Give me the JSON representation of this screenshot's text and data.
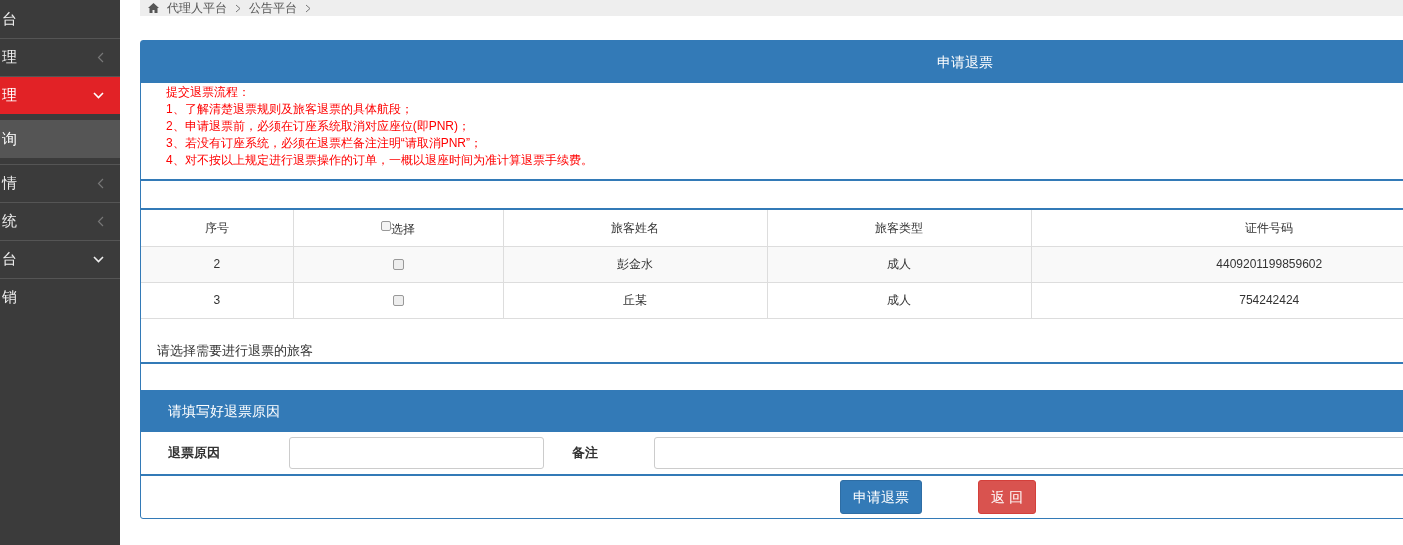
{
  "sidebar": {
    "items": [
      {
        "label": "台",
        "selected": false,
        "kind": "link"
      },
      {
        "label": "理",
        "selected": false,
        "kind": "collapsed"
      },
      {
        "label": "理",
        "selected": true,
        "kind": "expanded"
      },
      {
        "label": "询",
        "selected": false,
        "kind": "sub"
      },
      {
        "label": "情",
        "selected": false,
        "kind": "collapsed"
      },
      {
        "label": "统",
        "selected": false,
        "kind": "collapsed"
      },
      {
        "label": "台",
        "selected": false,
        "kind": "expanded"
      },
      {
        "label": "销",
        "selected": false,
        "kind": "link"
      }
    ]
  },
  "breadcrumb": [
    "代理人平台",
    "公告平台"
  ],
  "panel": {
    "title": "申请退票",
    "notice": [
      "提交退票流程：",
      "1、了解清楚退票规则及旅客退票的具体航段；",
      "2、申请退票前，必须在订座系统取消对应座位(即PNR)；",
      "3、若没有订座系统，必须在退票栏备注注明“请取消PNR”；",
      "4、对不按以上规定进行退票操作的订单，一概以退座时间为准计算退票手续费。"
    ],
    "table": {
      "select_all_checked": false,
      "columns": [
        "序号",
        "选择",
        "旅客姓名",
        "旅客类型",
        "证件号码"
      ],
      "rows": [
        {
          "no": "2",
          "checked": false,
          "name": "彭金水",
          "type": "成人",
          "id": "4409201199859602"
        },
        {
          "no": "3",
          "checked": false,
          "name": "丘某",
          "type": "成人",
          "id": "754242424"
        }
      ]
    },
    "hint": "请选择需要进行退票的旅客",
    "reason_title": "请填写好退票原因",
    "fields": [
      {
        "label": "退票原因"
      },
      {
        "label": "备注"
      }
    ],
    "buttons": [
      {
        "label": "申请退票",
        "kind": "primary"
      },
      {
        "label": "返 回",
        "kind": "danger"
      }
    ]
  }
}
